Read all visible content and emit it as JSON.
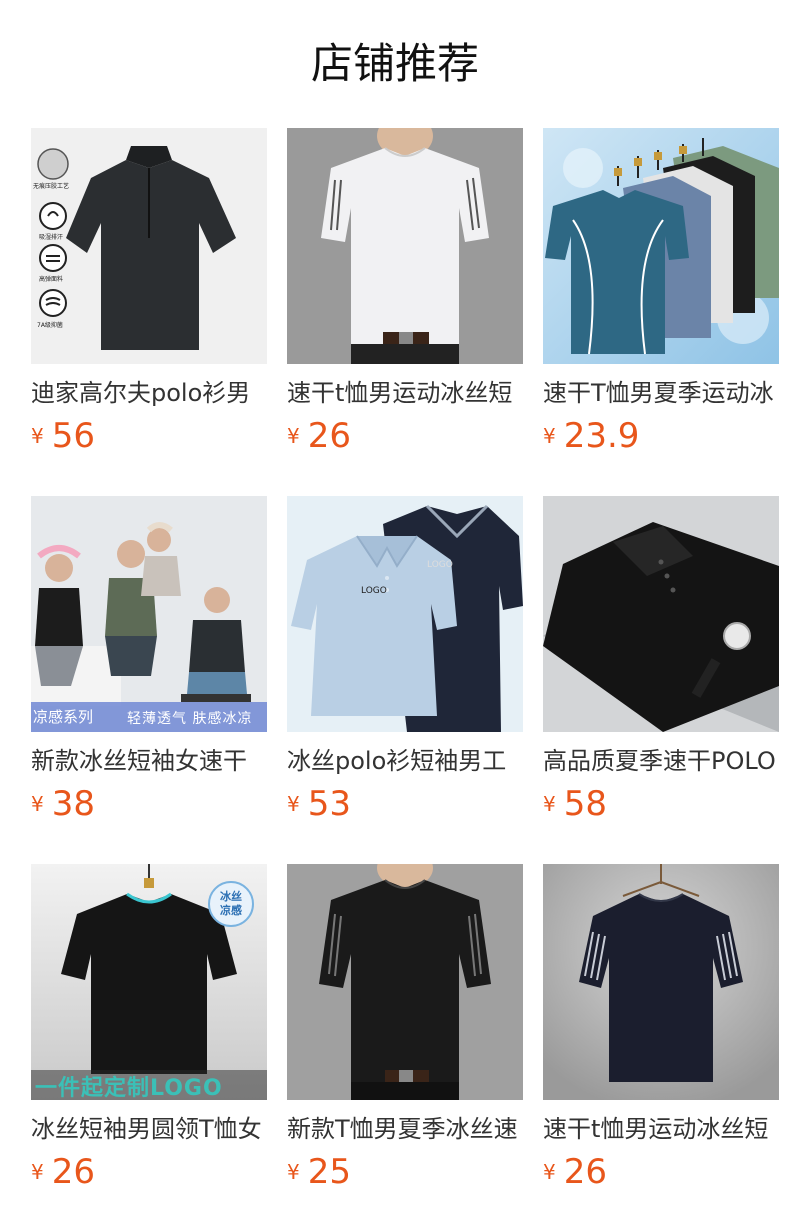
{
  "section": {
    "title": "店铺推荐"
  },
  "currency_symbol": "¥",
  "products": [
    {
      "name": "迪家高尔夫polo衫男",
      "price": "56",
      "image": "dark-half-zip-polo",
      "badges": [
        "无痕压胶工艺",
        "吸湿排汗",
        "高弹面料",
        "7A级抑菌"
      ]
    },
    {
      "name": "速干t恤男运动冰丝短",
      "price": "26",
      "image": "white-striped-tee-on-model"
    },
    {
      "name": "速干T恤男夏季运动冰",
      "price": "23.9",
      "image": "tees-on-hangers-ice-background"
    },
    {
      "name": "新款冰丝短袖女速干",
      "price": "38",
      "image": "group-photo-casual-tees",
      "overlay": {
        "left": "凉感系列",
        "right": "轻薄透气 肤感冰凉"
      }
    },
    {
      "name": "冰丝polo衫短袖男工",
      "price": "53",
      "image": "two-polos-logo",
      "overlay": {
        "logo1": "LOGO",
        "logo2": "LOGO"
      }
    },
    {
      "name": "高品质夏季速干POLO",
      "price": "58",
      "image": "folded-black-polo-with-watch"
    },
    {
      "name": "冰丝短袖男圆领T恤女",
      "price": "26",
      "image": "black-tee-on-hanger",
      "overlay": {
        "badge_line1": "冰丝",
        "badge_line2": "凉感",
        "banner": "一件起定制LOGO"
      }
    },
    {
      "name": "新款T恤男夏季冰丝速",
      "price": "25",
      "image": "black-tee-on-model"
    },
    {
      "name": "速干t恤男运动冰丝短",
      "price": "26",
      "image": "navy-tee-on-hanger-stripes"
    }
  ]
}
